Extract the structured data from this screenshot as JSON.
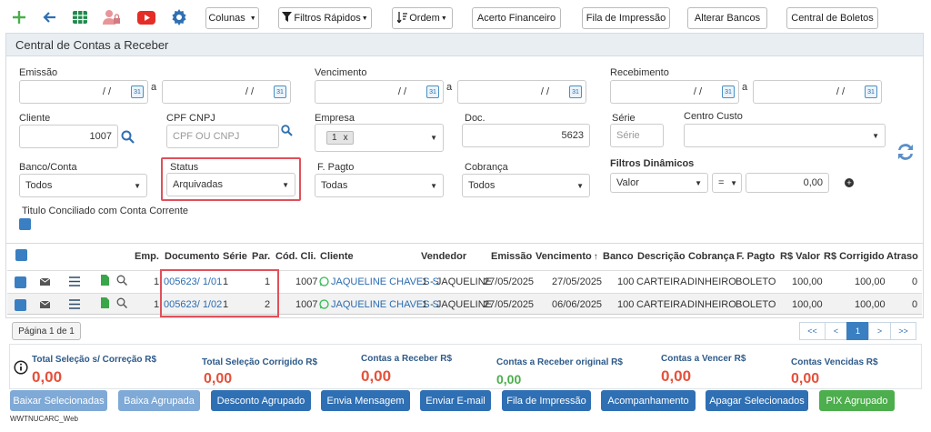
{
  "toolbar": {
    "colunas": "Colunas",
    "filtros_rapidos": "Filtros Rápidos",
    "ordem": "Ordem",
    "acerto_financeiro": "Acerto Financeiro",
    "fila_impressao": "Fila de Impressão",
    "alterar_bancos": "Alterar Bancos",
    "central_boletos": "Central de Boletos"
  },
  "panel": {
    "title": "Central de Contas a Receber"
  },
  "filters": {
    "emissao": "Emissão",
    "vencimento": "Vencimento",
    "recebimento": "Recebimento",
    "date_placeholder": "/ /",
    "a": "a",
    "cliente": "Cliente",
    "cliente_value": "1007",
    "cpf_cnpj": "CPF CNPJ",
    "cpf_placeholder": "CPF OU CNPJ",
    "empresa": "Empresa",
    "empresa_tag": "1",
    "empresa_tag_x": "x",
    "doc": "Doc.",
    "doc_value": "5623",
    "serie": "Série",
    "serie_placeholder": "Série",
    "centro_custo": "Centro Custo",
    "banco_conta": "Banco/Conta",
    "banco_value": "Todos",
    "status": "Status",
    "status_value": "Arquivadas",
    "f_pagto": "F. Pagto",
    "f_pagto_value": "Todas",
    "cobranca": "Cobrança",
    "cobranca_value": "Todos",
    "filtros_dinamicos": "Filtros Dinâmicos",
    "fd_campo": "Valor",
    "fd_op": "=",
    "fd_valor": "0,00",
    "titulo_conciliado": "Titulo Conciliado com Conta Corrente"
  },
  "grid": {
    "headers": {
      "emp": "Emp.",
      "documento": "Documento",
      "serie": "Série",
      "par": "Par.",
      "cod_cli": "Cód. Cli.",
      "cliente": "Cliente",
      "vendedor": "Vendedor",
      "emissao": "Emissão",
      "vencimento": "Vencimento",
      "banco": "Banco",
      "descricao": "Descrição",
      "cobranca": "Cobrança",
      "f_pagto": "F. Pagto",
      "valor": "R$ Valor",
      "corrigido": "R$ Corrigido",
      "atraso": "Atraso"
    },
    "rows": [
      {
        "emp": "1",
        "documento": "005623/ 1/01",
        "serie": "1",
        "par": "1",
        "cod_cli": "1007",
        "cliente": "JAQUELINE CHAVES S",
        "vendedor": "1 - JAQUELINE",
        "emissao": "27/05/2025",
        "vencimento": "27/05/2025",
        "banco": "100",
        "descricao": "CARTEIRA",
        "cobranca": "DINHEIRO",
        "f_pagto": "BOLETO",
        "valor": "100,00",
        "corrigido": "100,00",
        "atraso": "0"
      },
      {
        "emp": "1",
        "documento": "005623/ 1/02",
        "serie": "1",
        "par": "2",
        "cod_cli": "1007",
        "cliente": "JAQUELINE CHAVES S",
        "vendedor": "1 - JAQUELINE",
        "emissao": "27/05/2025",
        "vencimento": "06/06/2025",
        "banco": "100",
        "descricao": "CARTEIRA",
        "cobranca": "DINHEIRO",
        "f_pagto": "BOLETO",
        "valor": "100,00",
        "corrigido": "100,00",
        "atraso": "0"
      }
    ]
  },
  "pagination": {
    "label": "Página 1 de 1",
    "first": "<<",
    "prev": "<",
    "page": "1",
    "next": ">",
    "last": ">>"
  },
  "totals": {
    "sel_sem_correcao": "Total Seleção s/ Correção R$",
    "sel_sem_correcao_v": "0,00",
    "sel_corrigido": "Total Seleção Corrigido R$",
    "sel_corrigido_v": "0,00",
    "contas_receber": "Contas a Receber R$",
    "contas_receber_v": "0,00",
    "contas_receber_orig": "Contas a Receber original R$",
    "contas_receber_orig_v": "0,00",
    "contas_vencer": "Contas a Vencer R$",
    "contas_vencer_v": "0,00",
    "contas_vencidas": "Contas Vencidas R$",
    "contas_vencidas_v": "0,00"
  },
  "actions": {
    "baixar_selecionadas": "Baixar Selecionadas",
    "baixa_agrupada": "Baixa Agrupada",
    "desconto_agrupado": "Desconto Agrupado",
    "envia_mensagem": "Envia Mensagem",
    "enviar_email": "Enviar E-mail",
    "fila_impressao": "Fila de Impressão",
    "acompanhamento": "Acompanhamento",
    "apagar_selecionados": "Apagar Selecionados",
    "pix_agrupado": "PIX Agrupado"
  },
  "footer": {
    "program": "WWTNUCARC_Web"
  },
  "colors": {
    "primary": "#2f6fb3",
    "light_blue": "#7fa9d6",
    "green": "#4cae4c",
    "red_total": "#e6503a",
    "highlight": "#e0505a"
  }
}
